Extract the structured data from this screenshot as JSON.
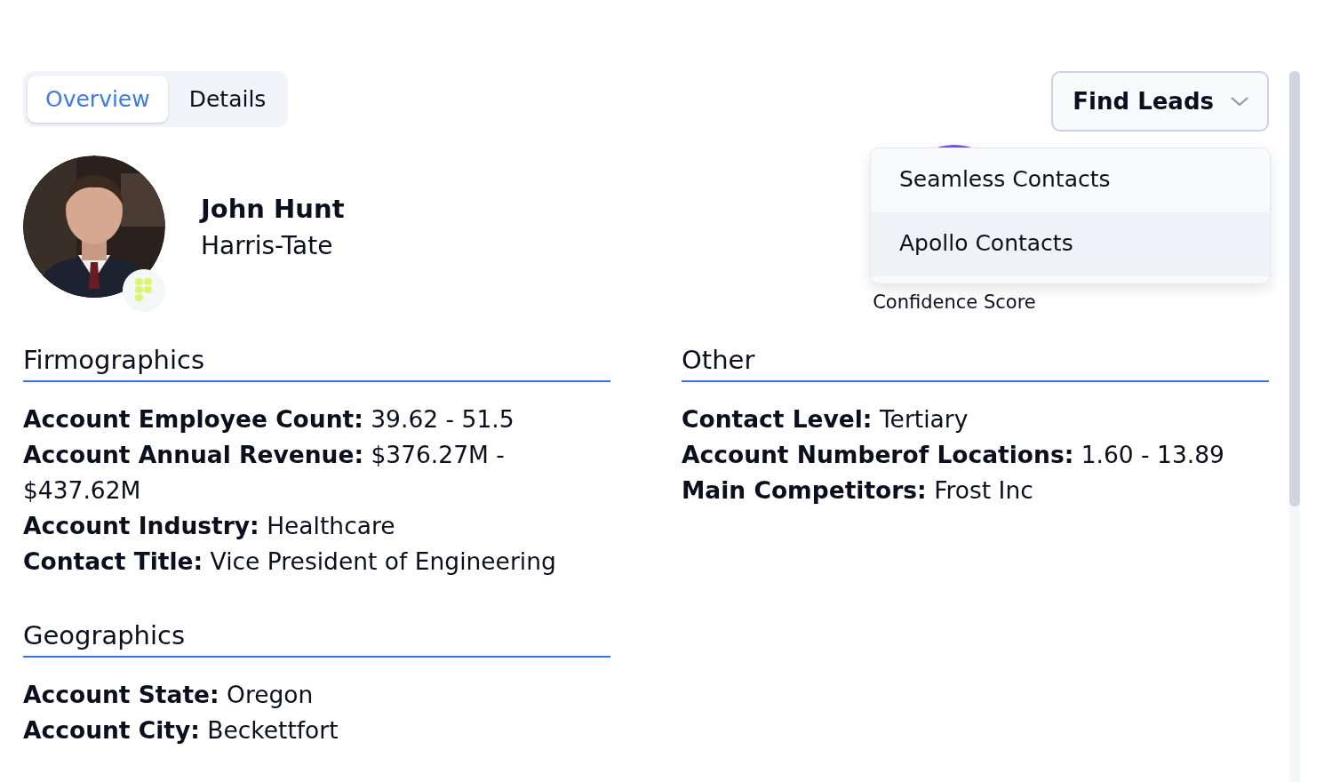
{
  "tabs": [
    {
      "label": "Overview",
      "selected": true
    },
    {
      "label": "Details",
      "selected": false
    }
  ],
  "find_leads": {
    "label": "Find Leads",
    "expanded": true,
    "menu": [
      {
        "label": "Seamless Contacts",
        "selected": false
      },
      {
        "label": "Apollo Contacts",
        "selected": true
      }
    ]
  },
  "profile": {
    "name": "John Hunt",
    "company": "Harris-Tate"
  },
  "confidence": {
    "label": "Confidence Score"
  },
  "sections": [
    {
      "title": "Firmographics",
      "fields": [
        "**Account Employee Count:** 39.62 - 51.5",
        "**Account Annual Revenue:** $376.27M - $437.62M",
        "**Account Industry:** Healthcare",
        "**Contact Title:** Vice President of Engineering"
      ]
    },
    {
      "title": "Geographics",
      "fields": [
        "**Account State:** Oregon",
        "**Account City:** Beckettfort"
      ]
    },
    {
      "title": "Other",
      "fields": [
        "**Contact Level:** Tertiary",
        "**Account Numberof Locations:** 1.60 - 13.89",
        "**Main Competitors:** Frost Inc"
      ]
    }
  ]
}
